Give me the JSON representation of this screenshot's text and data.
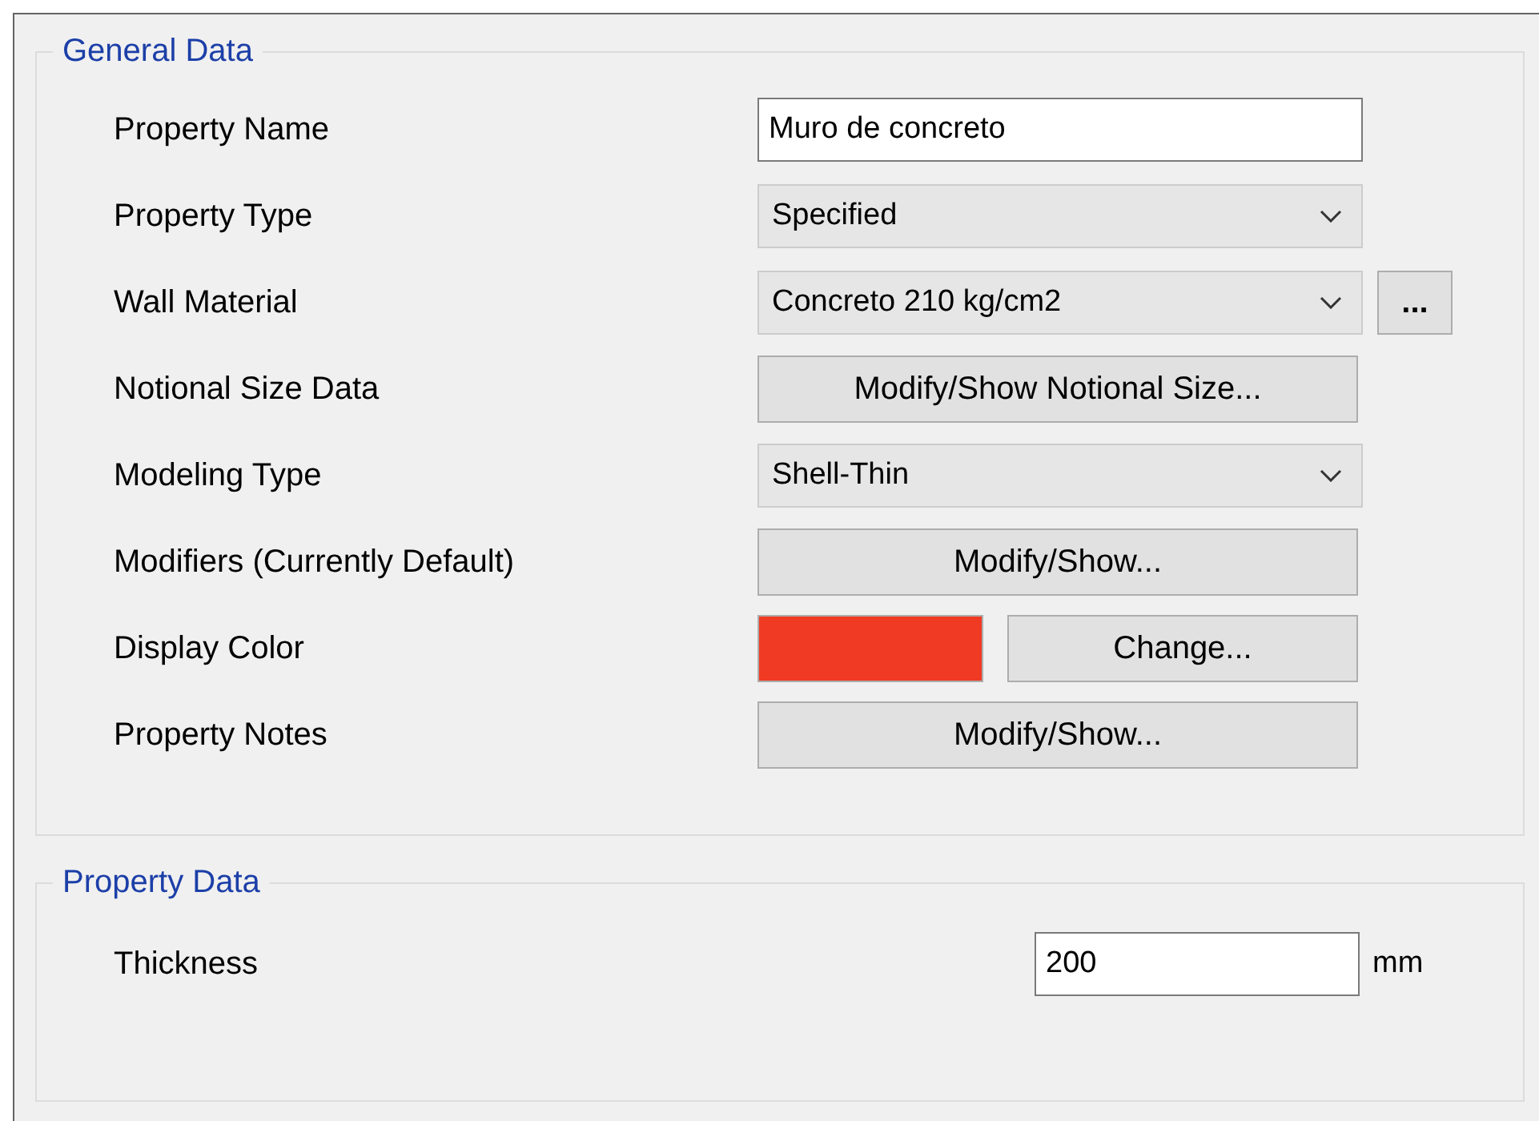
{
  "general_data": {
    "title": "General Data",
    "rows": [
      {
        "label": "Property Name",
        "kind": "text",
        "value": "Muro de concreto"
      },
      {
        "label": "Property Type",
        "kind": "dropdown",
        "value": "Specified"
      },
      {
        "label": "Wall Material",
        "kind": "dropdown",
        "value": "Concreto 210 kg/cm2",
        "more_button": "..."
      },
      {
        "label": "Notional Size Data",
        "kind": "button",
        "button": "Modify/Show Notional Size..."
      },
      {
        "label": "Modeling Type",
        "kind": "dropdown",
        "value": "Shell-Thin"
      },
      {
        "label": "Modifiers (Currently Default)",
        "kind": "button",
        "button": "Modify/Show..."
      },
      {
        "label": "Display Color",
        "kind": "color",
        "color": "#f03a24",
        "button": "Change..."
      },
      {
        "label": "Property Notes",
        "kind": "button",
        "button": "Modify/Show..."
      }
    ]
  },
  "property_data": {
    "title": "Property Data",
    "rows": [
      {
        "label": "Thickness",
        "value": "200",
        "unit": "mm"
      }
    ]
  }
}
